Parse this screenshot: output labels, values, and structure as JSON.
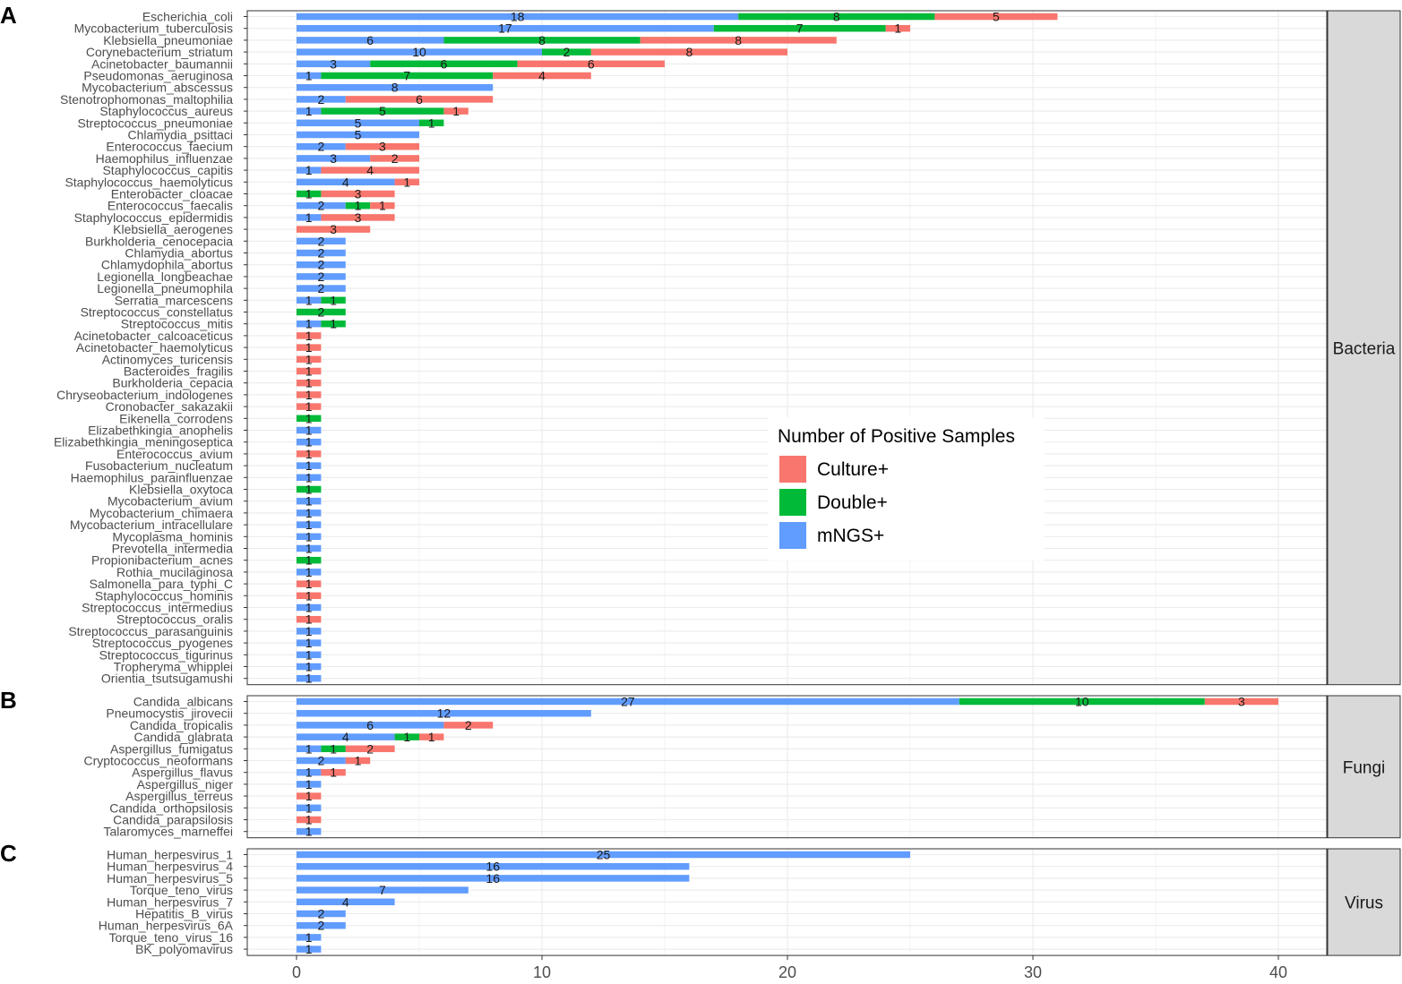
{
  "chart_data": {
    "type": "bar",
    "orientation": "horizontal",
    "stacked": true,
    "xlim": [
      0,
      42
    ],
    "xticks": [
      0,
      10,
      20,
      30,
      40
    ],
    "grid": true,
    "legend": {
      "title": "Number of Positive Samples",
      "placement": "inside-right",
      "entries": [
        {
          "key": "culture",
          "label": "Culture+"
        },
        {
          "key": "double",
          "label": "Double+"
        },
        {
          "key": "mngs",
          "label": "mNGS+"
        }
      ]
    },
    "colors": {
      "mngs": "#619CFF",
      "double": "#00BA38",
      "culture": "#F8766D"
    },
    "stack_order": [
      "mngs",
      "double",
      "culture"
    ],
    "panels": [
      {
        "letter": "A",
        "strip": "Bacteria",
        "rows": [
          {
            "name": "Escherichia_coli",
            "mngs": 18,
            "double": 8,
            "culture": 5
          },
          {
            "name": "Mycobacterium_tuberculosis",
            "mngs": 17,
            "double": 7,
            "culture": 1
          },
          {
            "name": "Klebsiella_pneumoniae",
            "mngs": 6,
            "double": 8,
            "culture": 8
          },
          {
            "name": "Corynebacterium_striatum",
            "mngs": 10,
            "double": 2,
            "culture": 8
          },
          {
            "name": "Acinetobacter_baumannii",
            "mngs": 3,
            "double": 6,
            "culture": 6
          },
          {
            "name": "Pseudomonas_aeruginosa",
            "mngs": 1,
            "double": 7,
            "culture": 4
          },
          {
            "name": "Mycobacterium_abscessus",
            "mngs": 8,
            "double": 0,
            "culture": 0
          },
          {
            "name": "Stenotrophomonas_maltophilia",
            "mngs": 2,
            "double": 0,
            "culture": 6
          },
          {
            "name": "Staphylococcus_aureus",
            "mngs": 1,
            "double": 5,
            "culture": 1
          },
          {
            "name": "Streptococcus_pneumoniae",
            "mngs": 5,
            "double": 1,
            "culture": 0
          },
          {
            "name": "Chlamydia_psittaci",
            "mngs": 5,
            "double": 0,
            "culture": 0
          },
          {
            "name": "Enterococcus_faecium",
            "mngs": 2,
            "double": 0,
            "culture": 3
          },
          {
            "name": "Haemophilus_influenzae",
            "mngs": 3,
            "double": 0,
            "culture": 2
          },
          {
            "name": "Staphylococcus_capitis",
            "mngs": 1,
            "double": 0,
            "culture": 4
          },
          {
            "name": "Staphylococcus_haemolyticus",
            "mngs": 4,
            "double": 0,
            "culture": 1
          },
          {
            "name": "Enterobacter_cloacae",
            "mngs": 0,
            "double": 1,
            "culture": 3
          },
          {
            "name": "Enterococcus_faecalis",
            "mngs": 2,
            "double": 1,
            "culture": 1
          },
          {
            "name": "Staphylococcus_epidermidis",
            "mngs": 1,
            "double": 0,
            "culture": 3
          },
          {
            "name": "Klebsiella_aerogenes",
            "mngs": 0,
            "double": 0,
            "culture": 3
          },
          {
            "name": "Burkholderia_cenocepacia",
            "mngs": 2,
            "double": 0,
            "culture": 0
          },
          {
            "name": "Chlamydia_abortus",
            "mngs": 2,
            "double": 0,
            "culture": 0
          },
          {
            "name": "Chlamydophila_abortus",
            "mngs": 2,
            "double": 0,
            "culture": 0
          },
          {
            "name": "Legionella_longbeachae",
            "mngs": 2,
            "double": 0,
            "culture": 0
          },
          {
            "name": "Legionella_pneumophila",
            "mngs": 2,
            "double": 0,
            "culture": 0
          },
          {
            "name": "Serratia_marcescens",
            "mngs": 1,
            "double": 1,
            "culture": 0
          },
          {
            "name": "Streptococcus_constellatus",
            "mngs": 0,
            "double": 2,
            "culture": 0
          },
          {
            "name": "Streptococcus_mitis",
            "mngs": 1,
            "double": 1,
            "culture": 0
          },
          {
            "name": "Acinetobacter_calcoaceticus",
            "mngs": 0,
            "double": 0,
            "culture": 1
          },
          {
            "name": "Acinetobacter_haemolyticus",
            "mngs": 0,
            "double": 0,
            "culture": 1
          },
          {
            "name": "Actinomyces_turicensis",
            "mngs": 0,
            "double": 0,
            "culture": 1
          },
          {
            "name": "Bacteroides_fragilis",
            "mngs": 0,
            "double": 0,
            "culture": 1
          },
          {
            "name": "Burkholderia_cepacia",
            "mngs": 0,
            "double": 0,
            "culture": 1
          },
          {
            "name": "Chryseobacterium_indologenes",
            "mngs": 0,
            "double": 0,
            "culture": 1
          },
          {
            "name": "Cronobacter_sakazakii",
            "mngs": 0,
            "double": 0,
            "culture": 1
          },
          {
            "name": "Eikenella_corrodens",
            "mngs": 0,
            "double": 1,
            "culture": 0
          },
          {
            "name": "Elizabethkingia_anophelis",
            "mngs": 1,
            "double": 0,
            "culture": 0
          },
          {
            "name": "Elizabethkingia_meningoseptica",
            "mngs": 1,
            "double": 0,
            "culture": 0
          },
          {
            "name": "Enterococcus_avium",
            "mngs": 0,
            "double": 0,
            "culture": 1
          },
          {
            "name": "Fusobacterium_nucleatum",
            "mngs": 1,
            "double": 0,
            "culture": 0
          },
          {
            "name": "Haemophilus_parainfluenzae",
            "mngs": 1,
            "double": 0,
            "culture": 0
          },
          {
            "name": "Klebsiella_oxytoca",
            "mngs": 0,
            "double": 1,
            "culture": 0
          },
          {
            "name": "Mycobacterium_avium",
            "mngs": 1,
            "double": 0,
            "culture": 0
          },
          {
            "name": "Mycobacterium_chimaera",
            "mngs": 1,
            "double": 0,
            "culture": 0
          },
          {
            "name": "Mycobacterium_intracellulare",
            "mngs": 1,
            "double": 0,
            "culture": 0
          },
          {
            "name": "Mycoplasma_hominis",
            "mngs": 1,
            "double": 0,
            "culture": 0
          },
          {
            "name": "Prevotella_intermedia",
            "mngs": 1,
            "double": 0,
            "culture": 0
          },
          {
            "name": "Propionibacterium_acnes",
            "mngs": 0,
            "double": 1,
            "culture": 0
          },
          {
            "name": "Rothia_mucilaginosa",
            "mngs": 1,
            "double": 0,
            "culture": 0
          },
          {
            "name": "Salmonella_para_typhi_C",
            "mngs": 0,
            "double": 0,
            "culture": 1
          },
          {
            "name": "Staphylococcus_hominis",
            "mngs": 0,
            "double": 0,
            "culture": 1
          },
          {
            "name": "Streptococcus_intermedius",
            "mngs": 1,
            "double": 0,
            "culture": 0
          },
          {
            "name": "Streptococcus_oralis",
            "mngs": 0,
            "double": 0,
            "culture": 1
          },
          {
            "name": "Streptococcus_parasanguinis",
            "mngs": 1,
            "double": 0,
            "culture": 0
          },
          {
            "name": "Streptococcus_pyogenes",
            "mngs": 1,
            "double": 0,
            "culture": 0
          },
          {
            "name": "Streptococcus_tigurinus",
            "mngs": 1,
            "double": 0,
            "culture": 0
          },
          {
            "name": "Tropheryma_whipplei",
            "mngs": 1,
            "double": 0,
            "culture": 0
          },
          {
            "name": "Orientia_tsutsugamushi",
            "mngs": 1,
            "double": 0,
            "culture": 0
          }
        ]
      },
      {
        "letter": "B",
        "strip": "Fungi",
        "rows": [
          {
            "name": "Candida_albicans",
            "mngs": 27,
            "double": 10,
            "culture": 3
          },
          {
            "name": "Pneumocystis_jirovecii",
            "mngs": 12,
            "double": 0,
            "culture": 0
          },
          {
            "name": "Candida_tropicalis",
            "mngs": 6,
            "double": 0,
            "culture": 2
          },
          {
            "name": "Candida_glabrata",
            "mngs": 4,
            "double": 1,
            "culture": 1
          },
          {
            "name": "Aspergillus_fumigatus",
            "mngs": 1,
            "double": 1,
            "culture": 2
          },
          {
            "name": "Cryptococcus_neoformans",
            "mngs": 2,
            "double": 0,
            "culture": 1
          },
          {
            "name": "Aspergillus_flavus",
            "mngs": 1,
            "double": 0,
            "culture": 1
          },
          {
            "name": "Aspergillus_niger",
            "mngs": 1,
            "double": 0,
            "culture": 0
          },
          {
            "name": "Aspergillus_terreus",
            "mngs": 0,
            "double": 0,
            "culture": 1
          },
          {
            "name": "Candida_orthopsilosis",
            "mngs": 1,
            "double": 0,
            "culture": 0
          },
          {
            "name": "Candida_parapsilosis",
            "mngs": 0,
            "double": 0,
            "culture": 1
          },
          {
            "name": "Talaromyces_marneffei",
            "mngs": 1,
            "double": 0,
            "culture": 0
          }
        ]
      },
      {
        "letter": "C",
        "strip": "Virus",
        "rows": [
          {
            "name": "Human_herpesvirus_1",
            "mngs": 25,
            "double": 0,
            "culture": 0
          },
          {
            "name": "Human_herpesvirus_4",
            "mngs": 16,
            "double": 0,
            "culture": 0
          },
          {
            "name": "Human_herpesvirus_5",
            "mngs": 16,
            "double": 0,
            "culture": 0
          },
          {
            "name": "Torque_teno_virus",
            "mngs": 7,
            "double": 0,
            "culture": 0
          },
          {
            "name": "Human_herpesvirus_7",
            "mngs": 4,
            "double": 0,
            "culture": 0
          },
          {
            "name": "Hepatitis_B_virus",
            "mngs": 2,
            "double": 0,
            "culture": 0
          },
          {
            "name": "Human_herpesvirus_6A",
            "mngs": 2,
            "double": 0,
            "culture": 0
          },
          {
            "name": "Torque_teno_virus_16",
            "mngs": 1,
            "double": 0,
            "culture": 0
          },
          {
            "name": "BK_polyomavirus",
            "mngs": 1,
            "double": 0,
            "culture": 0
          }
        ]
      }
    ]
  }
}
